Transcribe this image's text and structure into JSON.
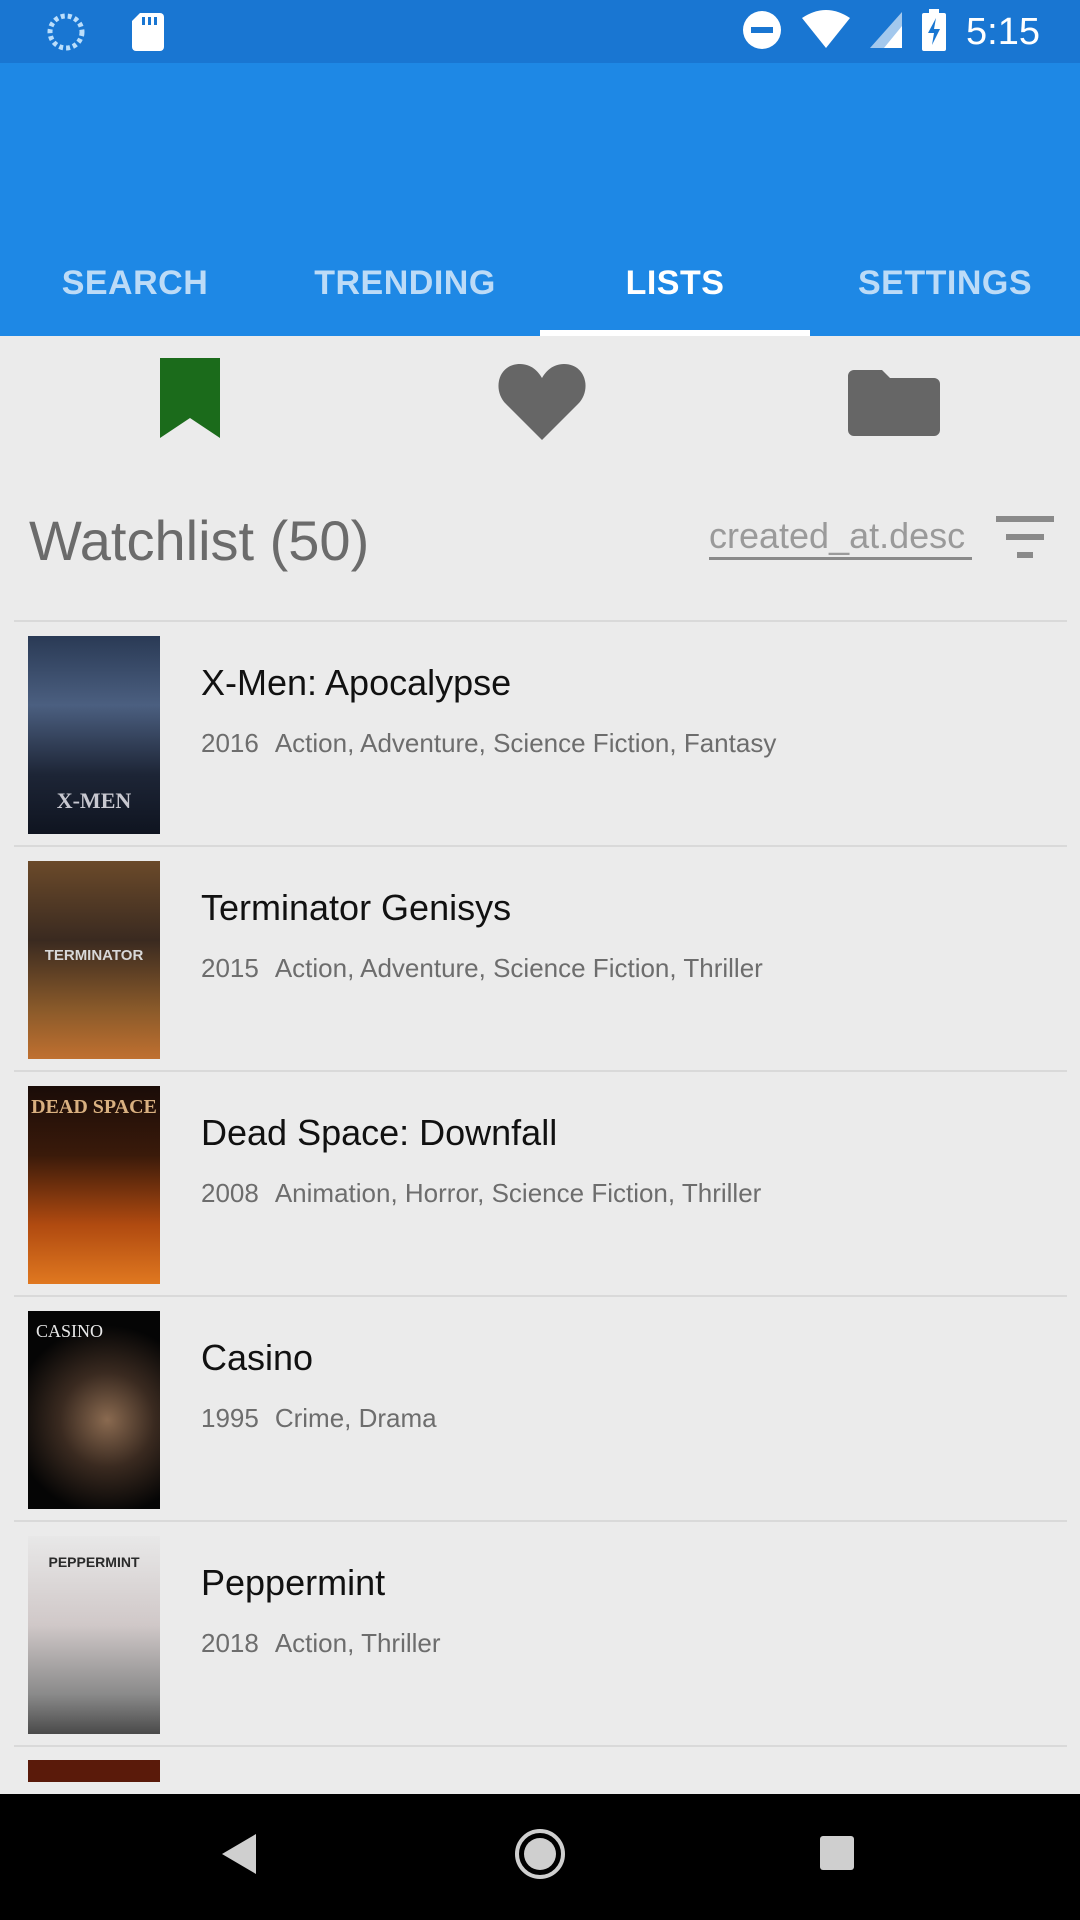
{
  "status_bar": {
    "time": "5:15"
  },
  "tabs": [
    {
      "label": "SEARCH",
      "active": false
    },
    {
      "label": "TRENDING",
      "active": false
    },
    {
      "label": "LISTS",
      "active": true
    },
    {
      "label": "SETTINGS",
      "active": false
    }
  ],
  "sub_tabs": [
    {
      "icon": "bookmark-icon",
      "active": true,
      "color": "#1b6b1b"
    },
    {
      "icon": "heart-icon",
      "active": false,
      "color": "#666666"
    },
    {
      "icon": "folder-icon",
      "active": false,
      "color": "#666666"
    }
  ],
  "list_header": {
    "title": "Watchlist (50)",
    "sort_value": "created_at.desc"
  },
  "movies": [
    {
      "title": "X-Men: Apocalypse",
      "year": "2016",
      "genres": "Action, Adventure, Science Fiction, Fantasy",
      "poster_text": "X-MEN"
    },
    {
      "title": "Terminator Genisys",
      "year": "2015",
      "genres": "Action, Adventure, Science Fiction, Thriller",
      "poster_text": "TERMINATOR"
    },
    {
      "title": "Dead Space: Downfall",
      "year": "2008",
      "genres": "Animation, Horror, Science Fiction, Thriller",
      "poster_text": "DEAD SPACE"
    },
    {
      "title": "Casino",
      "year": "1995",
      "genres": "Crime, Drama",
      "poster_text": "CASINO"
    },
    {
      "title": "Peppermint",
      "year": "2018",
      "genres": "Action, Thriller",
      "poster_text": "PEPPERMINT"
    }
  ],
  "colors": {
    "status_bar": "#1976d2",
    "app_bar": "#1e88e5",
    "background": "#ebebeb",
    "accent_bookmark": "#1b6b1b"
  }
}
